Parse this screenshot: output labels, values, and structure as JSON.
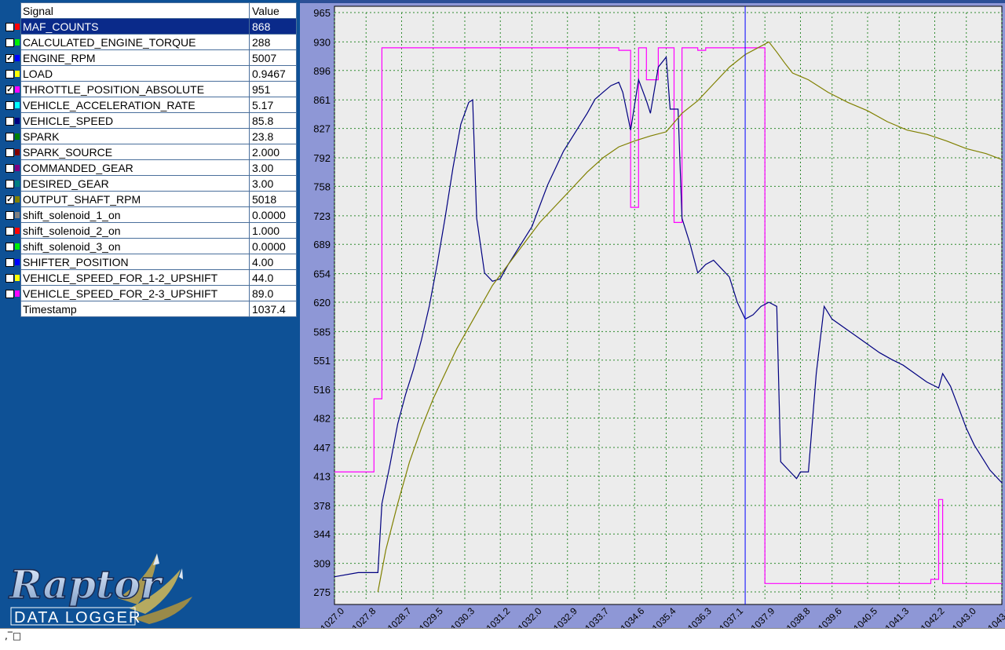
{
  "table": {
    "header": {
      "signal": "Signal",
      "value": "Value"
    },
    "rows": [
      {
        "name": "MAF_COUNTS",
        "value": "868",
        "checked": false,
        "color": "#ff0000",
        "selected": true
      },
      {
        "name": "CALCULATED_ENGINE_TORQUE",
        "value": "288",
        "checked": false,
        "color": "#00ee00"
      },
      {
        "name": "ENGINE_RPM",
        "value": "5007",
        "checked": true,
        "color": "#0000ff"
      },
      {
        "name": "LOAD",
        "value": "0.9467",
        "checked": false,
        "color": "#ffff00"
      },
      {
        "name": "THROTTLE_POSITION_ABSOLUTE",
        "value": "951",
        "checked": true,
        "color": "#ff00ff"
      },
      {
        "name": "VEHICLE_ACCELERATION_RATE",
        "value": "5.17",
        "checked": false,
        "color": "#00ffff"
      },
      {
        "name": "VEHICLE_SPEED",
        "value": "85.8",
        "checked": false,
        "color": "#000080"
      },
      {
        "name": "SPARK",
        "value": "23.8",
        "checked": false,
        "color": "#008000"
      },
      {
        "name": "SPARK_SOURCE",
        "value": "2.000",
        "checked": false,
        "color": "#800000"
      },
      {
        "name": "COMMANDED_GEAR",
        "value": "3.00",
        "checked": false,
        "color": "#800080"
      },
      {
        "name": "DESIRED_GEAR",
        "value": "3.00",
        "checked": false,
        "color": "#008080"
      },
      {
        "name": "OUTPUT_SHAFT_RPM",
        "value": "5018",
        "checked": true,
        "color": "#808000"
      },
      {
        "name": "shift_solenoid_1_on",
        "value": "0.0000",
        "checked": false,
        "color": "#808080"
      },
      {
        "name": "shift_solenoid_2_on",
        "value": "1.000",
        "checked": false,
        "color": "#ff0000"
      },
      {
        "name": "shift_solenoid_3_on",
        "value": "0.0000",
        "checked": false,
        "color": "#00ee00"
      },
      {
        "name": "SHIFTER_POSITION",
        "value": "4.00",
        "checked": false,
        "color": "#0000ff"
      },
      {
        "name": "VEHICLE_SPEED_FOR_1-2_UPSHIFT",
        "value": "44.0",
        "checked": false,
        "color": "#ffff00"
      },
      {
        "name": "VEHICLE_SPEED_FOR_2-3_UPSHIFT",
        "value": "89.0",
        "checked": false,
        "color": "#ff00ff"
      }
    ],
    "timestamp": {
      "label": "Timestamp",
      "value": "1037.4"
    }
  },
  "logo": {
    "brand": "Raptor",
    "subtitle": "DATA LOGGER"
  },
  "status": {
    "text": ",‾□"
  },
  "chart_data": {
    "type": "line",
    "title": "",
    "xlabel": "",
    "ylabel": "",
    "x_ticks": [
      "1027.0",
      "1027.8",
      "1028.7",
      "1029.5",
      "1030.3",
      "1031.2",
      "1032.0",
      "1032.9",
      "1033.7",
      "1034.6",
      "1035.4",
      "1036.3",
      "1037.1",
      "1037.9",
      "1038.8",
      "1039.6",
      "1040.5",
      "1041.3",
      "1042.2",
      "1043.0",
      "1043.9"
    ],
    "y_ticks": [
      "965",
      "930",
      "896",
      "861",
      "827",
      "792",
      "758",
      "723",
      "689",
      "654",
      "620",
      "585",
      "551",
      "516",
      "482",
      "447",
      "413",
      "378",
      "344",
      "309",
      "275"
    ],
    "xlim": [
      1027.0,
      1043.9
    ],
    "ylim": [
      275,
      965
    ],
    "cursor_x": 1037.4,
    "grid": true,
    "series": [
      {
        "color": "#ff00ff",
        "points": [
          [
            1027.0,
            418
          ],
          [
            1028.0,
            418
          ],
          [
            1028.0,
            505
          ],
          [
            1028.2,
            505
          ],
          [
            1028.2,
            923
          ],
          [
            1034.2,
            923
          ],
          [
            1034.2,
            920
          ],
          [
            1034.5,
            920
          ],
          [
            1034.5,
            733
          ],
          [
            1034.7,
            733
          ],
          [
            1034.7,
            923
          ],
          [
            1034.9,
            923
          ],
          [
            1034.9,
            885
          ],
          [
            1035.2,
            885
          ],
          [
            1035.2,
            923
          ],
          [
            1035.6,
            923
          ],
          [
            1035.6,
            715
          ],
          [
            1035.8,
            715
          ],
          [
            1035.8,
            923
          ],
          [
            1036.2,
            923
          ],
          [
            1036.2,
            920
          ],
          [
            1036.4,
            920
          ],
          [
            1036.4,
            923
          ],
          [
            1037.9,
            923
          ],
          [
            1037.9,
            285
          ],
          [
            1042.1,
            285
          ],
          [
            1042.1,
            290
          ],
          [
            1042.3,
            290
          ],
          [
            1042.3,
            385
          ],
          [
            1042.4,
            385
          ],
          [
            1042.4,
            285
          ],
          [
            1043.9,
            285
          ]
        ]
      },
      {
        "color": "#000080",
        "points": [
          [
            1027.0,
            293
          ],
          [
            1027.6,
            298
          ],
          [
            1028.1,
            298
          ],
          [
            1028.2,
            380
          ],
          [
            1028.4,
            425
          ],
          [
            1028.6,
            475
          ],
          [
            1028.8,
            510
          ],
          [
            1029.0,
            540
          ],
          [
            1029.2,
            575
          ],
          [
            1029.4,
            615
          ],
          [
            1029.6,
            665
          ],
          [
            1029.8,
            720
          ],
          [
            1030.0,
            780
          ],
          [
            1030.2,
            832
          ],
          [
            1030.4,
            858
          ],
          [
            1030.5,
            861
          ],
          [
            1030.6,
            720
          ],
          [
            1030.8,
            655
          ],
          [
            1031.0,
            645
          ],
          [
            1031.2,
            648
          ],
          [
            1031.4,
            665
          ],
          [
            1031.6,
            680
          ],
          [
            1031.8,
            695
          ],
          [
            1032.0,
            710
          ],
          [
            1032.2,
            735
          ],
          [
            1032.4,
            760
          ],
          [
            1032.6,
            780
          ],
          [
            1032.8,
            800
          ],
          [
            1033.0,
            815
          ],
          [
            1033.2,
            830
          ],
          [
            1033.4,
            845
          ],
          [
            1033.6,
            862
          ],
          [
            1033.8,
            870
          ],
          [
            1034.0,
            878
          ],
          [
            1034.2,
            882
          ],
          [
            1034.3,
            870
          ],
          [
            1034.5,
            825
          ],
          [
            1034.7,
            885
          ],
          [
            1034.9,
            860
          ],
          [
            1035.0,
            845
          ],
          [
            1035.2,
            900
          ],
          [
            1035.4,
            912
          ],
          [
            1035.5,
            850
          ],
          [
            1035.7,
            850
          ],
          [
            1035.8,
            720
          ],
          [
            1036.0,
            690
          ],
          [
            1036.2,
            655
          ],
          [
            1036.4,
            665
          ],
          [
            1036.6,
            670
          ],
          [
            1036.8,
            660
          ],
          [
            1037.0,
            650
          ],
          [
            1037.2,
            620
          ],
          [
            1037.4,
            600
          ],
          [
            1037.6,
            605
          ],
          [
            1037.8,
            615
          ],
          [
            1038.0,
            620
          ],
          [
            1038.2,
            615
          ],
          [
            1038.3,
            430
          ],
          [
            1038.5,
            420
          ],
          [
            1038.7,
            410
          ],
          [
            1038.8,
            418
          ],
          [
            1039.0,
            418
          ],
          [
            1039.2,
            535
          ],
          [
            1039.4,
            615
          ],
          [
            1039.6,
            600
          ],
          [
            1039.9,
            590
          ],
          [
            1040.2,
            580
          ],
          [
            1040.5,
            570
          ],
          [
            1040.8,
            560
          ],
          [
            1041.1,
            552
          ],
          [
            1041.4,
            545
          ],
          [
            1041.7,
            535
          ],
          [
            1042.0,
            525
          ],
          [
            1042.3,
            518
          ],
          [
            1042.4,
            535
          ],
          [
            1042.6,
            520
          ],
          [
            1042.8,
            495
          ],
          [
            1043.0,
            470
          ],
          [
            1043.2,
            450
          ],
          [
            1043.4,
            435
          ],
          [
            1043.6,
            420
          ],
          [
            1043.9,
            405
          ]
        ]
      },
      {
        "color": "#808000",
        "points": [
          [
            1028.1,
            275
          ],
          [
            1028.3,
            325
          ],
          [
            1028.6,
            380
          ],
          [
            1028.9,
            430
          ],
          [
            1029.2,
            470
          ],
          [
            1029.5,
            505
          ],
          [
            1029.8,
            535
          ],
          [
            1030.1,
            565
          ],
          [
            1030.4,
            590
          ],
          [
            1030.7,
            615
          ],
          [
            1031.0,
            640
          ],
          [
            1031.4,
            665
          ],
          [
            1031.8,
            690
          ],
          [
            1032.2,
            715
          ],
          [
            1032.6,
            735
          ],
          [
            1033.0,
            755
          ],
          [
            1033.4,
            775
          ],
          [
            1033.8,
            792
          ],
          [
            1034.2,
            805
          ],
          [
            1034.6,
            812
          ],
          [
            1035.0,
            818
          ],
          [
            1035.4,
            823
          ],
          [
            1035.8,
            845
          ],
          [
            1036.2,
            860
          ],
          [
            1036.6,
            880
          ],
          [
            1037.0,
            900
          ],
          [
            1037.4,
            915
          ],
          [
            1037.8,
            925
          ],
          [
            1038.0,
            930
          ],
          [
            1038.2,
            918
          ],
          [
            1038.4,
            905
          ],
          [
            1038.6,
            893
          ],
          [
            1039.0,
            885
          ],
          [
            1039.5,
            870
          ],
          [
            1040.0,
            858
          ],
          [
            1040.5,
            848
          ],
          [
            1041.0,
            835
          ],
          [
            1041.5,
            825
          ],
          [
            1042.0,
            820
          ],
          [
            1042.5,
            812
          ],
          [
            1043.0,
            803
          ],
          [
            1043.5,
            797
          ],
          [
            1043.9,
            790
          ]
        ]
      }
    ]
  }
}
